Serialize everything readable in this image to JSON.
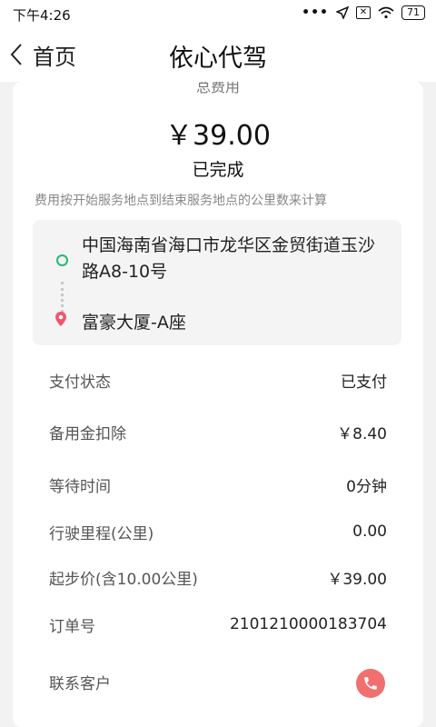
{
  "status_bar": {
    "time": "下午4:26",
    "dots": "•••",
    "battery": "71"
  },
  "nav": {
    "back_label": "首页",
    "title": "依心代驾"
  },
  "summary": {
    "fee_label": "总费用",
    "amount": "￥39.00",
    "status": "已完成",
    "note": "费用按开始服务地点到结束服务地点的公里数来计算"
  },
  "route": {
    "from": "中国海南省海口市龙华区金贸街道玉沙路A8-10号",
    "to": "富豪大厦-A座",
    "colors": {
      "start": "#2bb673",
      "end": "#f0576a"
    }
  },
  "details": [
    {
      "label": "支付状态",
      "value": "已支付"
    },
    {
      "label": "备用金扣除",
      "value": "￥8.40"
    },
    {
      "label": "等待时间",
      "value": "0分钟"
    },
    {
      "label": "行驶里程(公里)",
      "value": "0.00"
    },
    {
      "label": "起步价(含10.00公里)",
      "value": "￥39.00"
    },
    {
      "label": "订单号",
      "value": "2101210000183704"
    }
  ],
  "contact": {
    "label": "联系客户",
    "icon": "phone-icon",
    "color": "#f06f6f"
  }
}
